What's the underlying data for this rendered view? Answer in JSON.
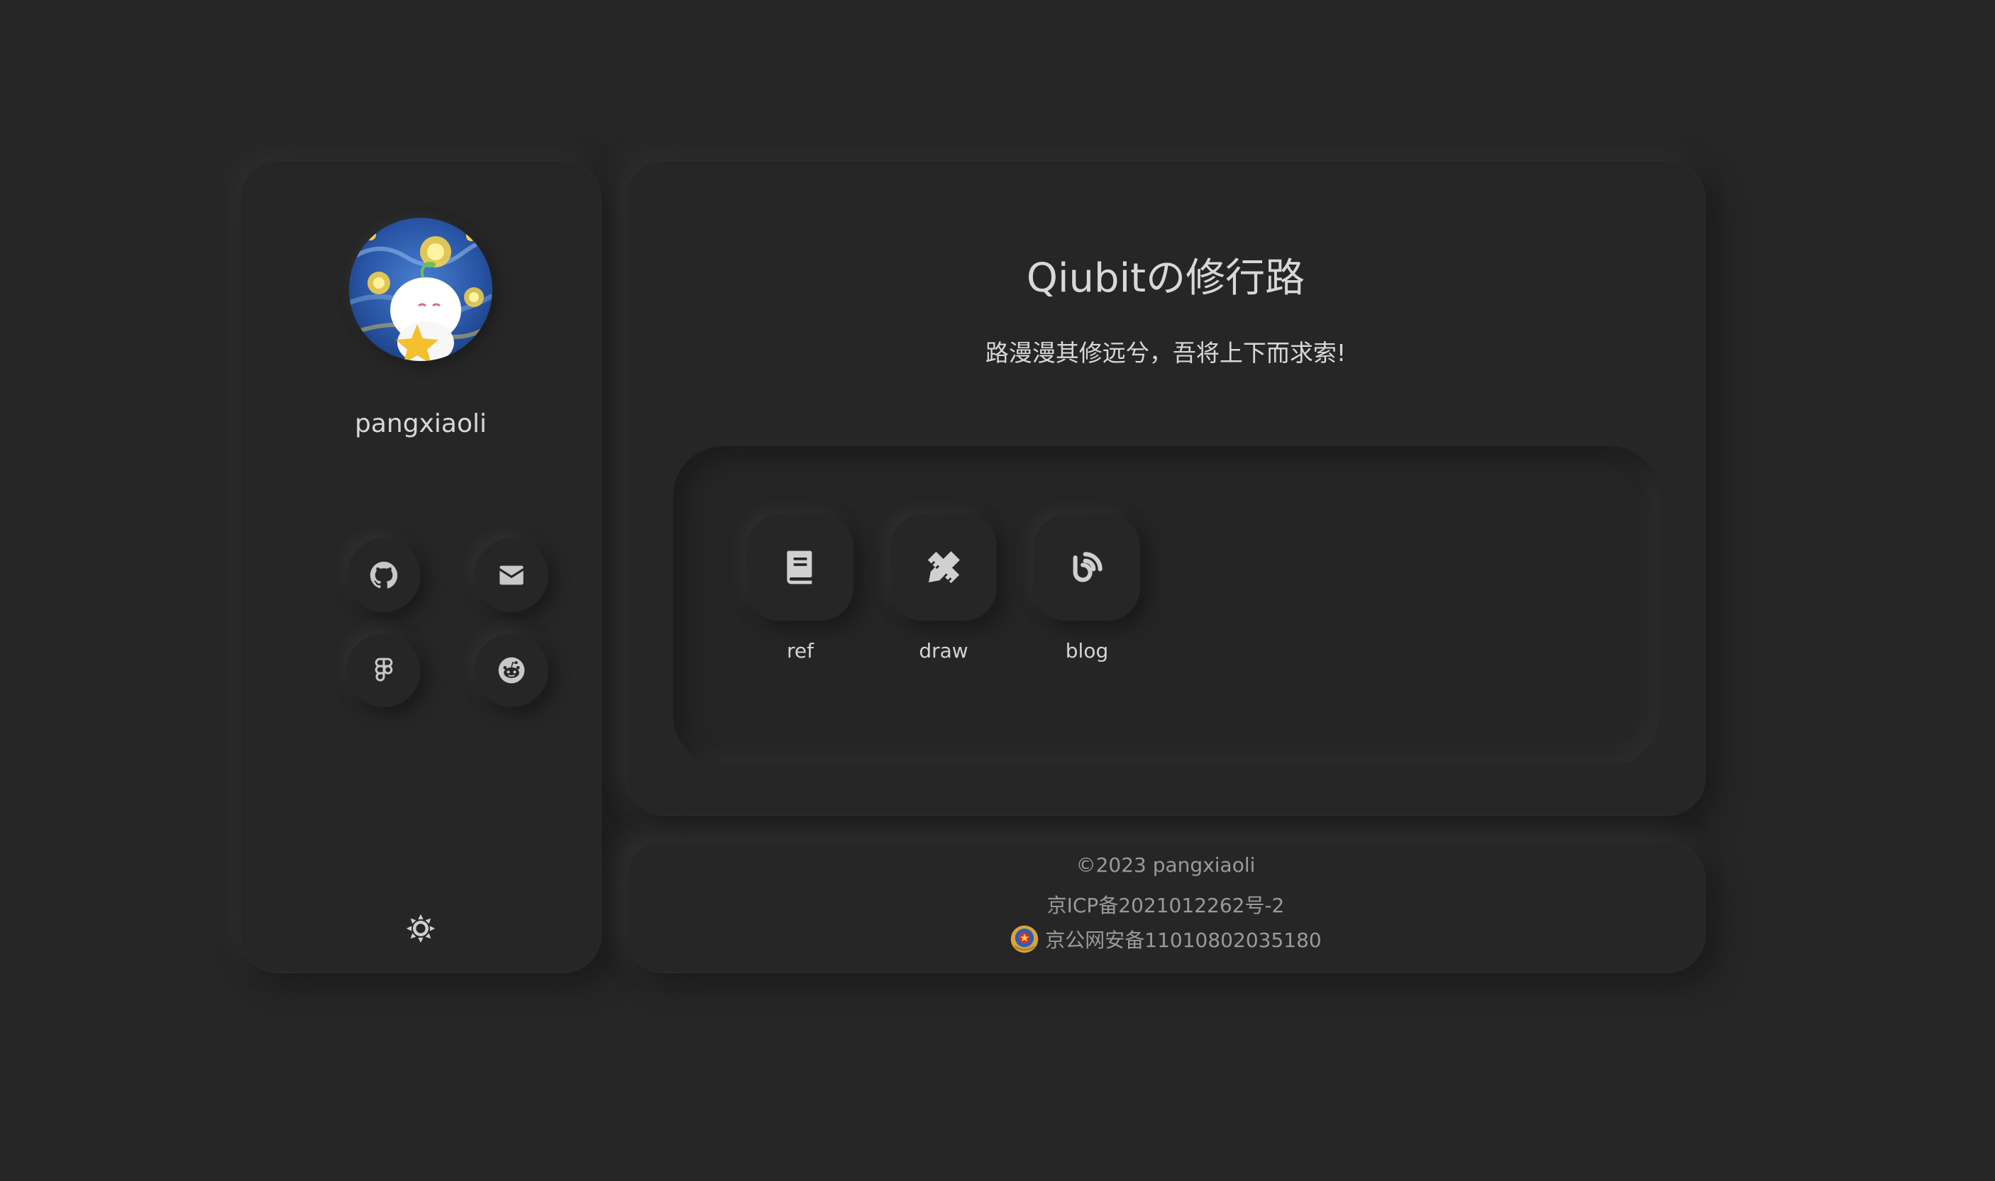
{
  "profile": {
    "username": "pangxiaoli"
  },
  "social": [
    {
      "name": "github",
      "icon": "github-icon"
    },
    {
      "name": "email",
      "icon": "envelope-icon"
    },
    {
      "name": "figma",
      "icon": "figma-icon"
    },
    {
      "name": "reddit",
      "icon": "reddit-icon"
    }
  ],
  "theme_toggle": {
    "icon": "sun-icon"
  },
  "main": {
    "title": "Qiubitの修行路",
    "subtitle": "路漫漫其修远兮，吾将上下而求索!"
  },
  "links": [
    {
      "label": "ref",
      "icon": "book-icon"
    },
    {
      "label": "draw",
      "icon": "pencil-ruler-icon"
    },
    {
      "label": "blog",
      "icon": "blog-icon"
    }
  ],
  "footer": {
    "copyright": "©2023 pangxiaoli",
    "icp": "京ICP备2021012262号-2",
    "police": "京公网安备11010802035180"
  },
  "colors": {
    "background": "#262626",
    "text": "#d8d8d8",
    "muted_text": "#9a9a9a"
  }
}
